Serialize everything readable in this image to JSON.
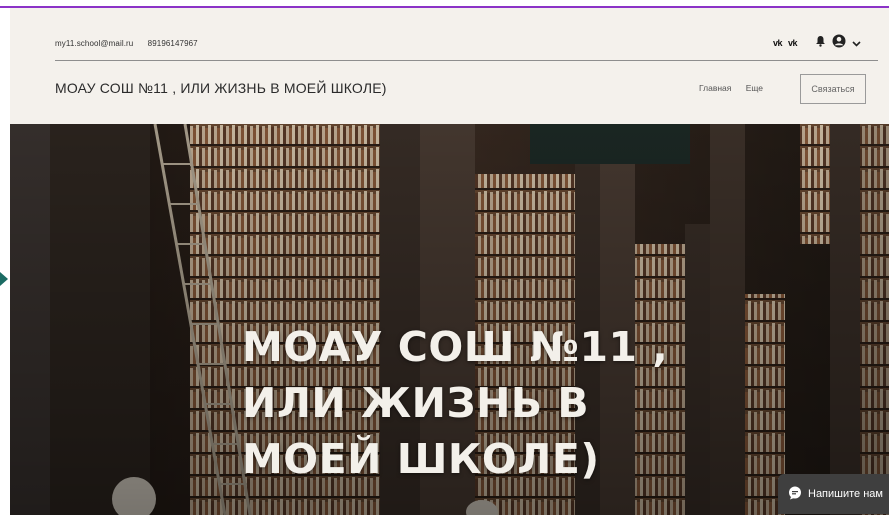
{
  "header": {
    "email": "my11.school@mail.ru",
    "phone": "89196147967",
    "site_title": "МОАУ СОШ №11 , ИЛИ ЖИЗНЬ В МОЕЙ ШКОЛЕ)",
    "nav": [
      {
        "label": "Главная"
      },
      {
        "label": "Еще"
      }
    ],
    "contact_button": "Связаться",
    "social": [
      "vk-icon",
      "vk-icon",
      "bell-icon",
      "user-icon",
      "chevron-down-icon"
    ],
    "vk_label_1": "vk",
    "vk_label_2": "vk"
  },
  "hero": {
    "title": "МОАУ СОШ №11 , ИЛИ ЖИЗНЬ В МОЕЙ ШКОЛЕ)",
    "image": "library-bookshelves-background"
  },
  "chat": {
    "label": "Напишите нам",
    "icon": "chat-bubble-icon"
  },
  "colors": {
    "accent_line": "#8b33c7",
    "header_bg": "#f4f1ec",
    "chat_bg": "#3f3f3f",
    "arrow": "#1b6b63"
  }
}
